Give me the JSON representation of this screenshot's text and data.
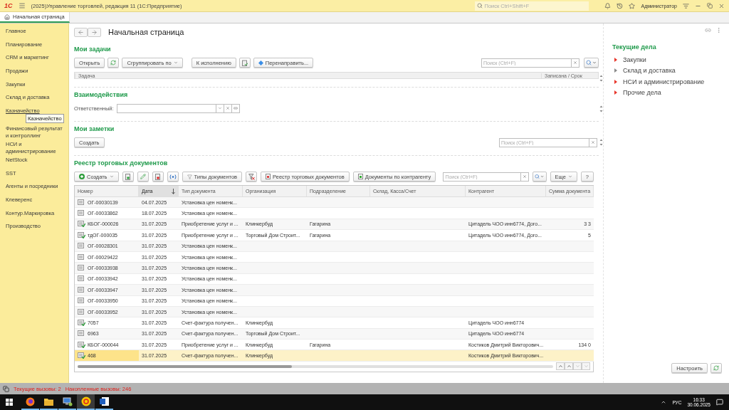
{
  "window": {
    "logo": "1С",
    "title": "(2025)Управление торговлей, редакция 11  (1С:Предприятие)",
    "search_placeholder": "Поиск Ctrl+Shift+F",
    "user": "Администратор"
  },
  "tabs": [
    {
      "label": "Начальная страница",
      "selected": true
    }
  ],
  "sidebar": {
    "items": [
      {
        "label": "Главное",
        "hovered": false
      },
      {
        "label": "Планирование",
        "hovered": false
      },
      {
        "label": "CRM и маркетинг",
        "hovered": false
      },
      {
        "label": "Продажи",
        "hovered": false
      },
      {
        "label": "Закупки",
        "hovered": false
      },
      {
        "label": "Склад и доставка",
        "hovered": false
      },
      {
        "label": "Казначейство",
        "hovered": true
      },
      {
        "label": "Финансовый результат и контроллинг",
        "hovered": false
      },
      {
        "label": "НСИ и администрирование",
        "hovered": false
      },
      {
        "label": "NetStock",
        "hovered": false
      },
      {
        "label": "SST",
        "hovered": false
      },
      {
        "label": "Агенты и посредники",
        "hovered": false
      },
      {
        "label": "Клеверенс",
        "hovered": false
      },
      {
        "label": "Контур.Маркировка",
        "hovered": false
      },
      {
        "label": "Производство",
        "hovered": false
      }
    ],
    "tooltip": "Казначейство"
  },
  "page": {
    "title": "Начальная страница"
  },
  "tasks": {
    "title": "Мои задачи",
    "open": "Открыть",
    "group": "Сгруппировать по",
    "execute": "К исполнению",
    "redirect": "Перенаправить...",
    "search_placeholder": "Поиск (Ctrl+F)",
    "columns": [
      "Задача",
      "Записана / Срок"
    ]
  },
  "interactions": {
    "title": "Взаимодействия",
    "responsible_label": "Ответственный:"
  },
  "notes": {
    "title": "Мои заметки",
    "create": "Создать",
    "search_placeholder": "Поиск (Ctrl+F)"
  },
  "registry": {
    "title": "Реестр торговых документов",
    "create": "Создать",
    "types": "Типы документов",
    "registry": "Реестр торговых документов",
    "by_contractor": "Документы по контрагенту",
    "search_placeholder": "Поиск (Ctrl+F)",
    "more": "Еще",
    "help": "?",
    "columns": [
      {
        "label": "Номер",
        "sorted": false
      },
      {
        "label": "Дата",
        "sorted": true
      },
      {
        "label": "Тип документа",
        "sorted": false
      },
      {
        "label": "Организация",
        "sorted": false
      },
      {
        "label": "Подразделение",
        "sorted": false
      },
      {
        "label": "Склад, Касса/Счет",
        "sorted": false
      },
      {
        "label": "Контрагент",
        "sorted": false
      },
      {
        "label": "Сумма документа",
        "sorted": false
      }
    ],
    "rows": [
      {
        "number": "ОГ-00030139",
        "date": "04.07.2025",
        "type": "Установка цен номенк...",
        "posted": false,
        "selected": false
      },
      {
        "number": "ОГ-00033862",
        "date": "18.07.2025",
        "type": "Установка цен номенк...",
        "posted": false,
        "selected": false
      },
      {
        "number": "КБОГ-000026",
        "date": "31.07.2025",
        "type": "Приобретение услуг и ...",
        "organization": "Клинкербуд",
        "department": "Гагарина",
        "contractor": "Цитадель ЧОО инн6774, Дого...",
        "amount": "3 3",
        "posted": true,
        "selected": false
      },
      {
        "number": "тдОГ-000035",
        "date": "31.07.2025",
        "type": "Приобретение услуг и ...",
        "organization": "Торговый Дом  Строит...",
        "department": "Гагарина",
        "contractor": "Цитадель ЧОО инн6774, Дого...",
        "amount": "5",
        "posted": true,
        "selected": false
      },
      {
        "number": "ОГ-00028301",
        "date": "31.07.2025",
        "type": "Установка цен номенк...",
        "posted": false,
        "selected": false
      },
      {
        "number": "ОГ-00029422",
        "date": "31.07.2025",
        "type": "Установка цен номенк...",
        "posted": false,
        "selected": false
      },
      {
        "number": "ОГ-00033938",
        "date": "31.07.2025",
        "type": "Установка цен номенк...",
        "posted": false,
        "selected": false
      },
      {
        "number": "ОГ-00033942",
        "date": "31.07.2025",
        "type": "Установка цен номенк...",
        "posted": false,
        "selected": false
      },
      {
        "number": "ОГ-00033947",
        "date": "31.07.2025",
        "type": "Установка цен номенк...",
        "posted": false,
        "selected": false
      },
      {
        "number": "ОГ-00033950",
        "date": "31.07.2025",
        "type": "Установка цен номенк...",
        "posted": false,
        "selected": false
      },
      {
        "number": "ОГ-00033952",
        "date": "31.07.2025",
        "type": "Установка цен номенк...",
        "posted": false,
        "selected": false
      },
      {
        "number": "7057",
        "date": "31.07.2025",
        "type": "Счет-фактура получен...",
        "organization": "Клинкербуд",
        "contractor": "Цитадель ЧОО инн6774",
        "posted": true,
        "selected": false
      },
      {
        "number": "6963",
        "date": "31.07.2025",
        "type": "Счет-фактура получен...",
        "organization": "Торговый Дом  Строит...",
        "contractor": "Цитадель ЧОО инн6774",
        "posted": false,
        "selected": false
      },
      {
        "number": "КБОГ-000044",
        "date": "31.07.2025",
        "type": "Приобретение услуг и ...",
        "organization": "Клинкербуд",
        "department": "Гагарина",
        "contractor": "Костиков Дмитрий Викторович...",
        "amount": "134 0",
        "posted": true,
        "selected": false
      },
      {
        "number": "468",
        "date": "31.07.2025",
        "type": "Счет-фактура получен...",
        "organization": "Клинкербуд",
        "contractor": "Костиков Дмитрий Викторович...",
        "posted": true,
        "selected": true
      }
    ]
  },
  "current": {
    "title": "Текущие дела",
    "items": [
      {
        "label": "Закупки",
        "color": "#e8372c"
      },
      {
        "label": "Склад и доставка",
        "color": "#8a8a8a"
      },
      {
        "label": "НСИ и администрирование",
        "color": "#e8372c"
      },
      {
        "label": "Прочие дела",
        "color": "#e8372c"
      }
    ],
    "settings": "Настроить"
  },
  "status_bar": {
    "current_calls": "Текущие вызовы: 2",
    "accumulated_calls": "Накопленные вызовы: 246"
  },
  "taskbar": {
    "apps": [
      {
        "kind": "browser",
        "selected": false
      },
      {
        "kind": "folder",
        "selected": false
      },
      {
        "kind": "computer",
        "selected": false
      },
      {
        "kind": "app",
        "selected": true
      },
      {
        "kind": "document",
        "selected": false
      }
    ],
    "language": "РУС",
    "time": "16:33",
    "date": "30.06.2025"
  }
}
